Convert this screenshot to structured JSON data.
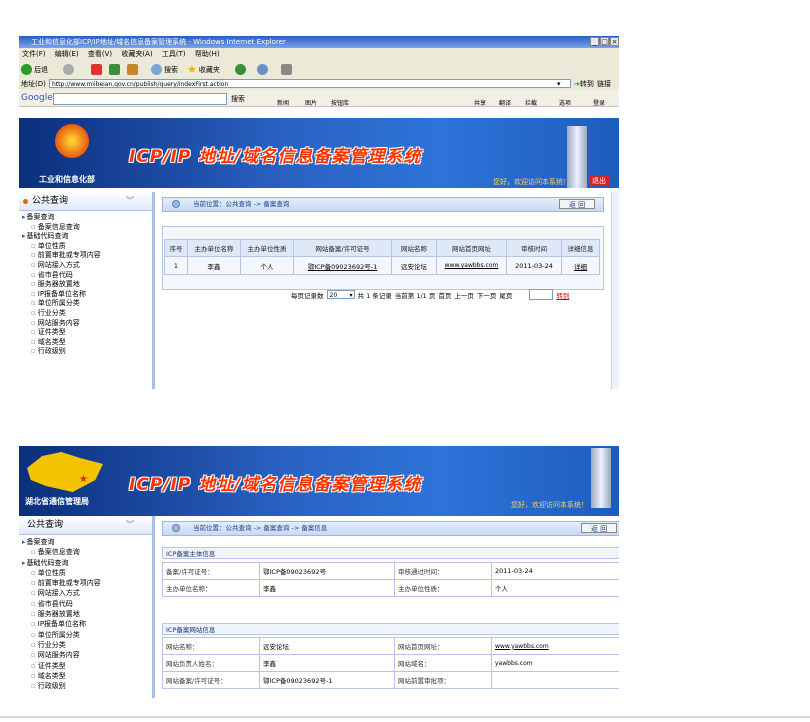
{
  "window": {
    "title": "工业和信息化部ICP/IP地址/域名信息备案管理系统 - Windows Internet Explorer",
    "controls": [
      "_",
      "□",
      "×"
    ]
  },
  "menu": [
    "文件(F)",
    "编辑(E)",
    "查看(V)",
    "收藏夹(A)",
    "工具(T)",
    "帮助(H)"
  ],
  "toolbar": {
    "back": "后退",
    "search": "搜索",
    "favorites": "收藏夹"
  },
  "address": {
    "label": "地址(D)",
    "url": "http://www.miibeian.gov.cn/publish/query/indexFirst.action",
    "go": "转到",
    "links": "链接"
  },
  "google": {
    "logo": "Google",
    "search": "搜索",
    "items": [
      "新闻",
      "图片",
      "按钮库",
      "共享",
      "翻译",
      "拦截",
      "选项",
      "登录"
    ]
  },
  "banner": {
    "system_title": "ICP/IP 地址/域名信息备案管理系统",
    "org_top": "工业和信息化部",
    "org_bottom": "湖北省通信管理局",
    "welcome": "您好，欢迎访问本系统！",
    "exit": "退出"
  },
  "sidebar": {
    "header": "公共查询",
    "groups": [
      {
        "label": "备案查询",
        "items": [
          "备案信息查询"
        ]
      },
      {
        "label": "基础代码查询",
        "items": [
          "单位性质",
          "前置审批或专项内容",
          "网站接入方式",
          "省市县代码",
          "服务器放置地",
          "IP报备单位名称",
          "单位所属分类",
          "行业分类",
          "网站服务内容",
          "证件类型",
          "域名类型",
          "行政级别"
        ]
      }
    ]
  },
  "top": {
    "breadcrumb": "当前位置：公共查询  ->  备案查询",
    "back": "返 回",
    "table": {
      "headers": [
        "序号",
        "主办单位名称",
        "主办单位性质",
        "网站备案/许可证号",
        "网站名称",
        "网站首页网址",
        "审核时间",
        "详细信息"
      ],
      "rows": [
        [
          "1",
          "李鑫",
          "个人",
          "鄂ICP备09023692号-1",
          "远安论坛",
          "www.yawbbs.com",
          "2011-03-24",
          "详细"
        ]
      ]
    },
    "pager": {
      "per_page_label": "每页记录数",
      "per_page": "20",
      "total": "共 1 条记录",
      "current": "当前第 1/1 页",
      "first": "首页",
      "prev": "上一页",
      "next": "下一页",
      "last": "尾页",
      "jump": "转到"
    }
  },
  "bottom": {
    "breadcrumb": "当前位置：公共查询  ->  备案查询  ->  备案信息",
    "back": "返 回",
    "subject_section": "ICP备案主体信息",
    "subject": [
      [
        "备案/许可证号：",
        "鄂ICP备09023692号",
        "审核通过时间：",
        "2011-03-24"
      ],
      [
        "主办单位名称：",
        "李鑫",
        "主办单位性质：",
        "个人"
      ]
    ],
    "site_section": "ICP备案网站信息",
    "site": [
      [
        "网站名称：",
        "远安论坛",
        "网站首页网址：",
        "www.yawbbs.com"
      ],
      [
        "网站负责人姓名：",
        "李鑫",
        "网站域名：",
        "yawbbs.com"
      ],
      [
        "网站备案/许可证号：",
        "鄂ICP备09023692号-1",
        "网站前置审批项：",
        ""
      ]
    ]
  },
  "colors": {
    "banner_dark": "#0b2f7c",
    "banner_light": "#2d74d8",
    "title_red": "#ff3300",
    "sidebar_border": "#a8c0e8",
    "table_border": "#b4c6e4"
  }
}
